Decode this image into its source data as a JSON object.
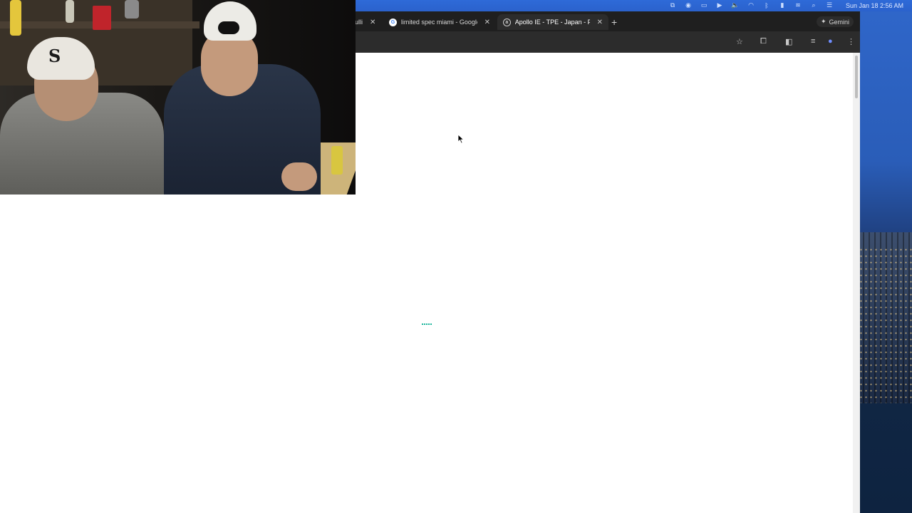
{
  "menubar": {
    "clock": "Sun Jan 18  2:56 AM",
    "icons": [
      "screen-icon",
      "record-icon",
      "display-icon",
      "play-icon",
      "volume-icon",
      "wifi-alt-icon",
      "bluetooth-icon",
      "battery-icon",
      "wifi-icon",
      "search-icon",
      "control-center-icon"
    ]
  },
  "browser": {
    "tabs": [
      {
        "title": "ulli",
        "active": false,
        "favicon": "none"
      },
      {
        "title": "limited spec miami - Google S",
        "active": false,
        "favicon": "google-icon"
      },
      {
        "title": "Apollo IE - TPE - Japan - For",
        "active": true,
        "favicon": "apollo-icon"
      }
    ],
    "gemini_label": "Gemini",
    "page_state": "loading"
  },
  "webcam": {
    "present": true
  }
}
